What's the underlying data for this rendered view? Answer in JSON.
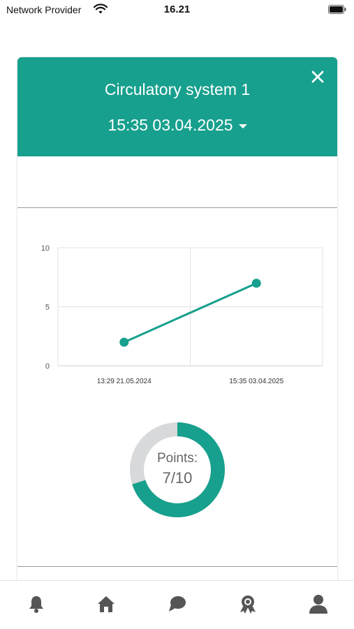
{
  "status_bar": {
    "provider": "Network Provider",
    "time": "16.21"
  },
  "dialog": {
    "title": "Circulatory system 1",
    "date": "15:35 03.04.2025",
    "accent_color": "#17a08d"
  },
  "chart_data": {
    "type": "line",
    "x": [
      "13:29 21.05.2024",
      "15:35 03.04.2025"
    ],
    "values": [
      2,
      7
    ],
    "ylim": [
      0,
      10
    ],
    "y_ticks": [
      "0",
      "5",
      "10"
    ],
    "grid": true,
    "color": "#17a08d"
  },
  "score": {
    "label": "Points:",
    "value_text": "7/10",
    "points": 7,
    "max": 10
  },
  "tabs": [
    {
      "icon": "bell-icon"
    },
    {
      "icon": "home-icon"
    },
    {
      "icon": "chat-icon"
    },
    {
      "icon": "award-icon"
    },
    {
      "icon": "user-icon"
    }
  ]
}
